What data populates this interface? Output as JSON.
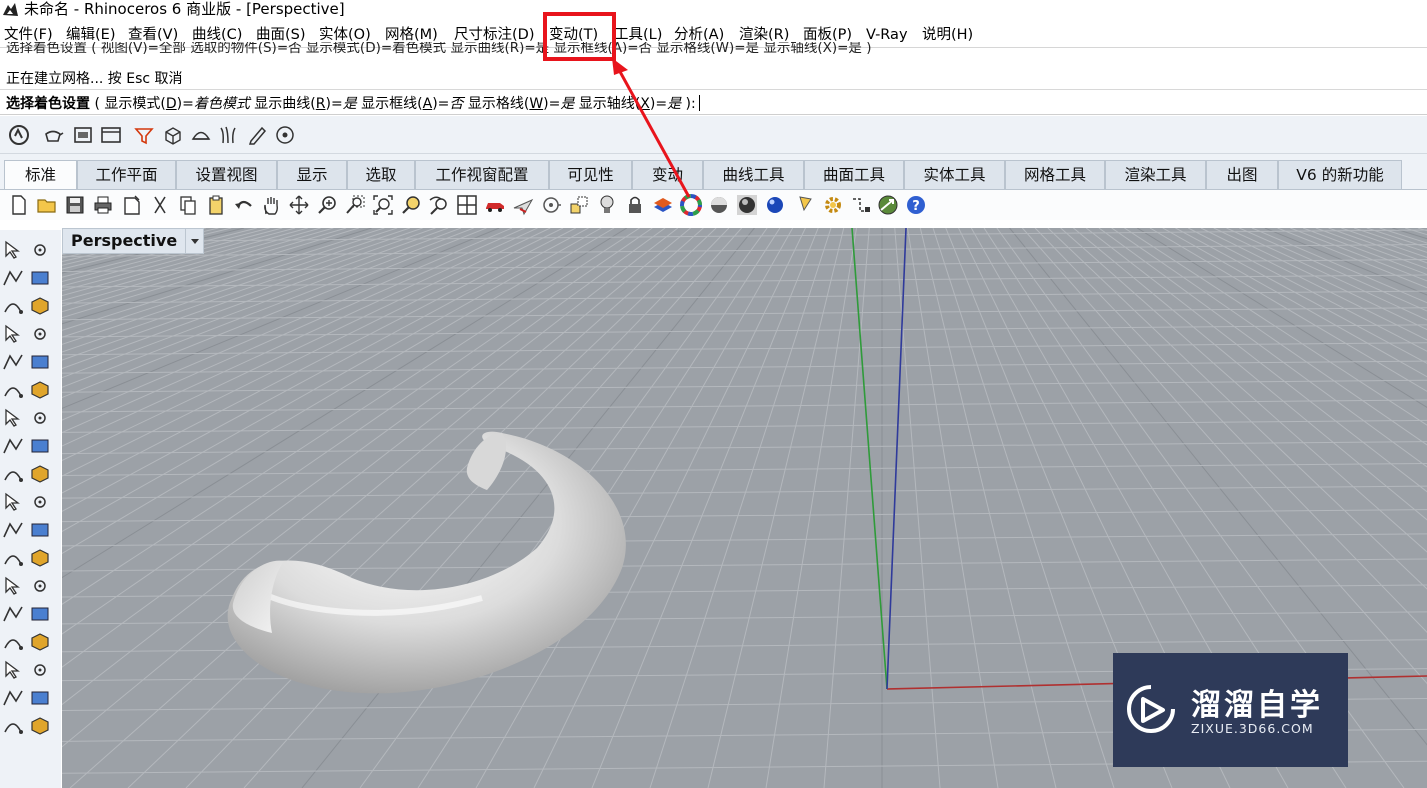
{
  "titlebar": {
    "title": "未命名 - Rhinoceros 6 商业版 - [Perspective]"
  },
  "menu": [
    "文件(F)",
    "编辑(E)",
    "查看(V)",
    "曲线(C)",
    "曲面(S)",
    "实体(O)",
    "网格(M)",
    "尺寸标注(D)",
    "变动(T)",
    "工具(L)",
    "分析(A)",
    "渲染(R)",
    "面板(P)",
    "V-Ray",
    "说明(H)"
  ],
  "command": {
    "history_1": "选择着色设置 ( 视图(V)=全部  选取的物件(S)=否  显示模式(D)=着色模式  显示曲线(R)=是  显示框线(A)=否  显示格线(W)=是  显示轴线(X)=是 )",
    "history_2": "正在建立网格... 按 Esc 取消",
    "prompt": {
      "label": "选择着色设置",
      "open": " ( ",
      "opt1": "显示模式(",
      "opt1_key": "D",
      "opt1_close": ")=",
      "opt1_val": "着色模式",
      "opt2": " 显示曲线(",
      "opt2_key": "R",
      "opt2_close": ")=",
      "opt2_val": "是",
      "opt3": " 显示框线(",
      "opt3_key": "A",
      "opt3_close": ")=",
      "opt3_val": "否",
      "opt4": " 显示格线(",
      "opt4_key": "W",
      "opt4_close": ")=",
      "opt4_val": "是",
      "opt5": " 显示轴线(",
      "opt5_key": "X",
      "opt5_close": ")=",
      "opt5_val": "是",
      "end": " ):"
    }
  },
  "tabs": [
    "标准",
    "工作平面",
    "设置视图",
    "显示",
    "选取",
    "工作视窗配置",
    "可见性",
    "变动",
    "曲线工具",
    "曲面工具",
    "实体工具",
    "网格工具",
    "渲染工具",
    "出图",
    "V6 的新功能"
  ],
  "active_tab": "标准",
  "viewport": {
    "name": "Perspective"
  },
  "highlighted_menu": "变动(T)",
  "watermark": {
    "name": "溜溜自学",
    "url": "ZIXUE.3D66.COM"
  },
  "colors": {
    "viewport_bg": "#9ca1a7",
    "axis_x": "#b03030",
    "axis_y": "#2f9b3a",
    "axis_z": "#2f3a9b",
    "annotation": "#e8141c"
  }
}
